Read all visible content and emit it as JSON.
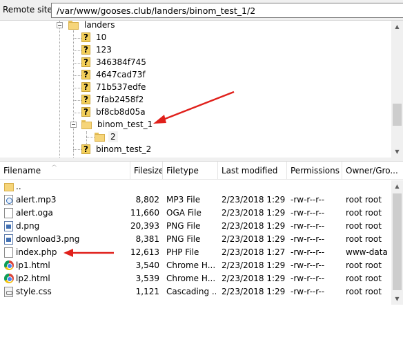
{
  "remote_site": {
    "label": "Remote site:",
    "path": "/var/www/gooses.club/landers/binom_test_1/2"
  },
  "tree": {
    "nodes": [
      {
        "label": "landers",
        "icon": "folder-icon"
      },
      {
        "label": "10",
        "icon": "unknown-folder-icon"
      },
      {
        "label": "123",
        "icon": "unknown-folder-icon"
      },
      {
        "label": "346384f745",
        "icon": "unknown-folder-icon"
      },
      {
        "label": "4647cad73f",
        "icon": "unknown-folder-icon"
      },
      {
        "label": "71b537edfe",
        "icon": "unknown-folder-icon"
      },
      {
        "label": "7fab2458f2",
        "icon": "unknown-folder-icon"
      },
      {
        "label": "bf8cb8d05a",
        "icon": "unknown-folder-icon"
      },
      {
        "label": "binom_test_1",
        "icon": "folder-icon"
      },
      {
        "label": "2",
        "icon": "folder-icon"
      },
      {
        "label": "binom_test_2",
        "icon": "unknown-folder-icon"
      }
    ]
  },
  "columns": {
    "filename": "Filename",
    "filesize": "Filesize",
    "filetype": "Filetype",
    "last_modified": "Last modified",
    "permissions": "Permissions",
    "owner": "Owner/Gro..."
  },
  "files": [
    {
      "name": "..",
      "size": "",
      "type": "",
      "modified": "",
      "perms": "",
      "owner": "",
      "icon": "folder-icon"
    },
    {
      "name": "alert.mp3",
      "size": "8,802",
      "type": "MP3 File",
      "modified": "2/23/2018 1:29:...",
      "perms": "-rw-r--r--",
      "owner": "root root",
      "icon": "audio-file-icon"
    },
    {
      "name": "alert.oga",
      "size": "11,660",
      "type": "OGA File",
      "modified": "2/23/2018 1:29:...",
      "perms": "-rw-r--r--",
      "owner": "root root",
      "icon": "blank-file-icon"
    },
    {
      "name": "d.png",
      "size": "20,393",
      "type": "PNG File",
      "modified": "2/23/2018 1:29:...",
      "perms": "-rw-r--r--",
      "owner": "root root",
      "icon": "image-file-icon"
    },
    {
      "name": "download3.png",
      "size": "8,381",
      "type": "PNG File",
      "modified": "2/23/2018 1:29:...",
      "perms": "-rw-r--r--",
      "owner": "root root",
      "icon": "image-file-icon"
    },
    {
      "name": "index.php",
      "size": "12,613",
      "type": "PHP File",
      "modified": "2/23/2018 1:27:...",
      "perms": "-rw-r--r--",
      "owner": "www-data ...",
      "icon": "blank-file-icon"
    },
    {
      "name": "lp1.html",
      "size": "3,540",
      "type": "Chrome H...",
      "modified": "2/23/2018 1:29:...",
      "perms": "-rw-r--r--",
      "owner": "root root",
      "icon": "chrome-icon"
    },
    {
      "name": "lp2.html",
      "size": "3,539",
      "type": "Chrome H...",
      "modified": "2/23/2018 1:29:...",
      "perms": "-rw-r--r--",
      "owner": "root root",
      "icon": "chrome-icon"
    },
    {
      "name": "style.css",
      "size": "1,121",
      "type": "Cascading ...",
      "modified": "2/23/2018 1:29:...",
      "perms": "-rw-r--r--",
      "owner": "root root",
      "icon": "css-file-icon"
    }
  ],
  "colors": {
    "annotation_arrow": "#e0201b",
    "folder": "#f6d57a",
    "selection": "#f3f3f3"
  }
}
